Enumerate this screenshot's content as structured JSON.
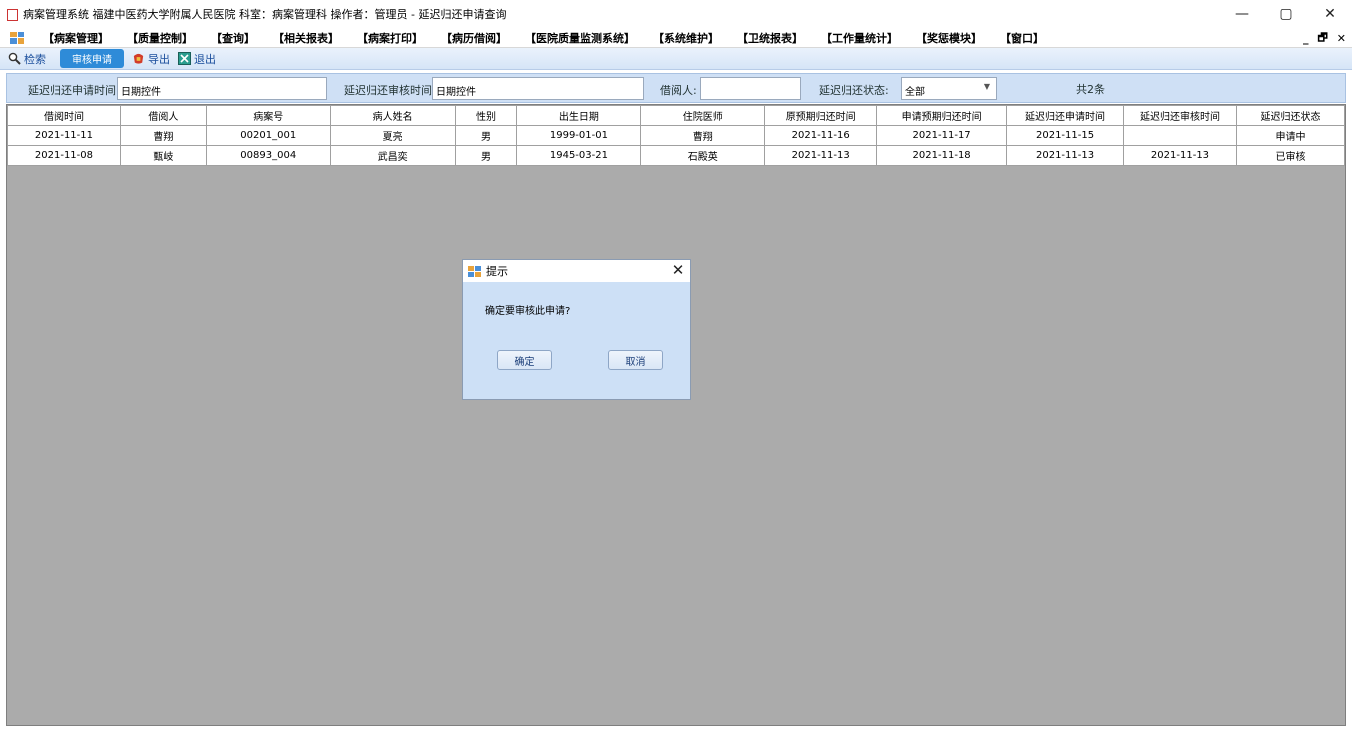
{
  "window": {
    "title": "病案管理系统 福建中医药大学附属人民医院 科室：病案管理科 操作者：管理员 - 延迟归还申请查询",
    "controls": {
      "minimize": "—",
      "maximize": "▢",
      "close": "✕"
    }
  },
  "menu": {
    "items": [
      "【病案管理】",
      "【质量控制】",
      "【查询】",
      "【相关报表】",
      "【病案打印】",
      "【病历借阅】",
      "【医院质量监测系统】",
      "【系统维护】",
      "【卫统报表】",
      "【工作量统计】",
      "【奖惩模块】",
      "【窗口】"
    ],
    "mdi": {
      "minimize": "_",
      "restore": "🗗",
      "close": "✕"
    }
  },
  "toolbar": {
    "search": "检索",
    "review": "审核申请",
    "export": "导出",
    "exit": "退出"
  },
  "filters": {
    "apply_time_label": "延迟归还申请时间:",
    "apply_time_value": "日期控件",
    "review_time_label": "延迟归还审核时间:",
    "review_time_value": "日期控件",
    "borrower_label": "借阅人:",
    "borrower_value": "",
    "status_label": "延迟归还状态:",
    "status_value": "全部",
    "count": "共2条"
  },
  "table": {
    "columns": [
      "借阅时间",
      "借阅人",
      "病案号",
      "病人姓名",
      "性别",
      "出生日期",
      "住院医师",
      "原预期归还时间",
      "申请预期归还时间",
      "延迟归还申请时间",
      "延迟归还审核时间",
      "延迟归还状态"
    ],
    "rows": [
      [
        "2021-11-11",
        "曹翔",
        "00201_001",
        "夏亮",
        "男",
        "1999-01-01",
        "曹翔",
        "2021-11-16",
        "2021-11-17",
        "2021-11-15",
        "",
        "申请中"
      ],
      [
        "2021-11-08",
        "甄岐",
        "00893_004",
        "武昌奕",
        "男",
        "1945-03-21",
        "石殿英",
        "2021-11-13",
        "2021-11-18",
        "2021-11-13",
        "2021-11-13",
        "已审核"
      ]
    ]
  },
  "dialog": {
    "title": "提示",
    "message": "确定要审核此申请?",
    "ok": "确定",
    "cancel": "取消",
    "close": "✕"
  },
  "colors": {
    "toolbar_active": "#2e8bd8",
    "filter_bg": "#cfe0f5",
    "grid_bg": "#ababab",
    "dialog_bg": "#cde0f6"
  }
}
